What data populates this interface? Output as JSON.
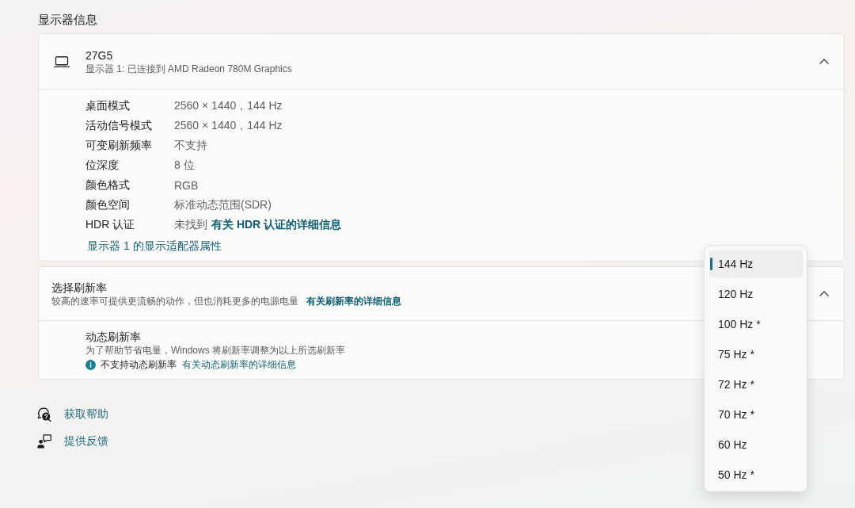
{
  "section_title": "显示器信息",
  "display_card": {
    "expanded": true,
    "name": "27G5",
    "subtitle": "显示器 1: 已连接到 AMD Radeon 780M Graphics",
    "properties": [
      {
        "label": "桌面模式",
        "value": "2560 × 1440，144 Hz"
      },
      {
        "label": "活动信号模式",
        "value": "2560 × 1440，144 Hz"
      },
      {
        "label": "可变刷新频率",
        "value": "不支持"
      },
      {
        "label": "位深度",
        "value": "8 位"
      },
      {
        "label": "颜色格式",
        "value": "RGB"
      },
      {
        "label": "颜色空间",
        "value": "标准动态范围(SDR)"
      },
      {
        "label": "HDR 认证",
        "value": "未找到",
        "link": "有关 HDR 认证的详细信息"
      }
    ],
    "adapter_link": "显示器 1 的显示适配器属性"
  },
  "refresh_card": {
    "expanded": true,
    "title": "选择刷新率",
    "description": "较高的速率可提供更流畅的动作，但也消耗更多的电源电量",
    "link": "有关刷新率的详细信息",
    "dynamic_refresh": {
      "title": "动态刷新率",
      "description": "为了帮助节省电量，Windows 将刷新率调整为以上所选刷新率",
      "notice": "不支持动态刷新率",
      "link": "有关动态刷新率的详细信息"
    }
  },
  "help_links": [
    {
      "label": "获取帮助"
    },
    {
      "label": "提供反馈"
    }
  ],
  "refresh_menu": {
    "items": [
      {
        "label": "144 Hz",
        "selected": true
      },
      {
        "label": "120 Hz",
        "selected": false
      },
      {
        "label": "100 Hz *",
        "selected": false
      },
      {
        "label": "75 Hz *",
        "selected": false
      },
      {
        "label": "72 Hz *",
        "selected": false
      },
      {
        "label": "70 Hz *",
        "selected": false
      },
      {
        "label": "60 Hz",
        "selected": false
      },
      {
        "label": "50 Hz *",
        "selected": false
      }
    ]
  }
}
